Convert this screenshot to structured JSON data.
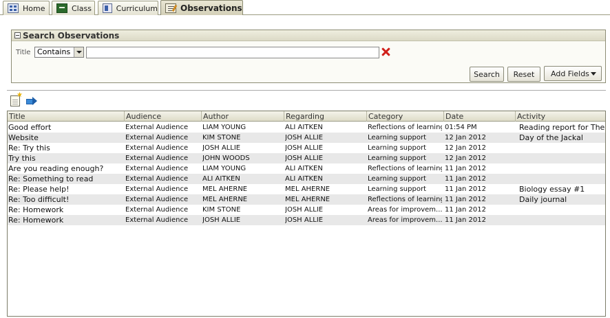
{
  "tabs": [
    {
      "label": "Home",
      "icon": "home-icon"
    },
    {
      "label": "Class",
      "icon": "class-icon"
    },
    {
      "label": "Curriculum",
      "icon": "curriculum-icon"
    },
    {
      "label": "Observations",
      "icon": "observations-icon",
      "active": true
    }
  ],
  "search": {
    "title": "Search Observations",
    "field_label": "Title",
    "operator": "Contains",
    "value": "",
    "search_label": "Search",
    "reset_label": "Reset",
    "add_fields_label": "Add Fields"
  },
  "toolbar": {
    "new_icon": "new-document-icon",
    "go_icon": "arrow-right-icon"
  },
  "table": {
    "columns": [
      "Title",
      "Audience",
      "Author",
      "Regarding",
      "Category",
      "Date",
      "Activity"
    ],
    "rows": [
      [
        "Good effort",
        "External Audience",
        "LIAM YOUNG",
        "ALI AITKEN",
        "Reflections of learning",
        "01:54 PM",
        "Reading report for The"
      ],
      [
        "Website",
        "External Audience",
        "KIM STONE",
        "JOSH ALLIE",
        "Learning support",
        "12 Jan 2012",
        "Day of the Jackal"
      ],
      [
        "Re: Try this",
        "External Audience",
        "JOSH ALLIE",
        "JOSH ALLIE",
        "Learning support",
        "12 Jan 2012",
        ""
      ],
      [
        "Try this",
        "External Audience",
        "JOHN WOODS",
        "JOSH ALLIE",
        "Learning support",
        "12 Jan 2012",
        ""
      ],
      [
        "Are you reading enough?",
        "External Audience",
        "LIAM YOUNG",
        "ALI AITKEN",
        "Reflections of learning",
        "11 Jan 2012",
        ""
      ],
      [
        "Re: Something to read",
        "External Audience",
        "ALI AITKEN",
        "ALI AITKEN",
        "Learning support",
        "11 Jan 2012",
        ""
      ],
      [
        "Re: Please help!",
        "External Audience",
        "MEL AHERNE",
        "MEL AHERNE",
        "Learning support",
        "11 Jan 2012",
        "Biology essay #1"
      ],
      [
        "Re: Too difficult!",
        "External Audience",
        "MEL AHERNE",
        "MEL AHERNE",
        "Reflections of learning",
        "11 Jan 2012",
        "Daily journal"
      ],
      [
        "Re: Homework",
        "External Audience",
        "KIM STONE",
        "JOSH ALLIE",
        "Areas for improvem...",
        "11 Jan 2012",
        ""
      ],
      [
        "Re: Homework",
        "External Audience",
        "JOSH ALLIE",
        "JOSH ALLIE",
        "Areas for improvem...",
        "11 Jan 2012",
        ""
      ]
    ]
  }
}
